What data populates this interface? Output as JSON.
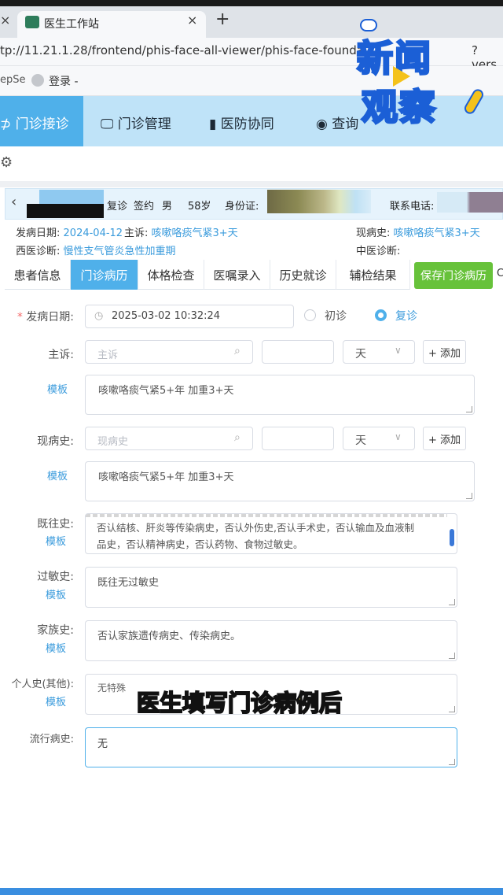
{
  "browser": {
    "tab_close_left": "×",
    "tab_title": "医生工作站",
    "tab_close": "×",
    "new_tab": "+",
    "url": "tp://11.21.1.28/frontend/phis-face-all-viewer/phis-face-founda",
    "url_tail": "?vers",
    "bookmark_left": "epSe",
    "bookmark_login": "登录 -"
  },
  "nav": {
    "items": [
      {
        "label": "门诊接诊"
      },
      {
        "label": "门诊管理"
      },
      {
        "label": "医防协同"
      },
      {
        "label": "查询"
      }
    ]
  },
  "patient": {
    "visit_type": "复诊",
    "contract": "签约",
    "sex": "男",
    "age": "58岁",
    "id_label": "身份证:",
    "phone_label": "联系电话:",
    "onset_label": "发病日期:",
    "onset_date": "2024-04-12",
    "complaint_label": "主诉:",
    "complaint": "咳嗽咯痰气紧3+天",
    "present_label": "现病史:",
    "present": "咳嗽咯痰气紧3+天",
    "western_dx_label": "西医诊断:",
    "western_dx": "慢性支气管炎急性加重期",
    "chinese_dx_label": "中医诊断:"
  },
  "subtabs": {
    "items": [
      {
        "label": "患者信息"
      },
      {
        "label": "门诊病历"
      },
      {
        "label": "体格检查"
      },
      {
        "label": "医嘱录入"
      },
      {
        "label": "历史就诊"
      },
      {
        "label": "辅检结果"
      }
    ],
    "save_label": "保存门诊病历",
    "edge_mark": "C"
  },
  "form": {
    "onset_label": "发病日期:",
    "onset_required": "*",
    "onset_value": "2025-03-02 10:32:24",
    "first_visit": "初诊",
    "return_visit": "复诊",
    "complaint_label": "主诉:",
    "complaint_placeholder": "主诉",
    "unit_day": "天",
    "add_label": "+ 添加",
    "template_label": "模板",
    "complaint_text": "咳嗽咯痰气紧5+年  加重3+天",
    "present_label": "现病史:",
    "present_placeholder": "现病史",
    "present_text": "咳嗽咯痰气紧5+年  加重3+天",
    "past_label": "既往史:",
    "past_line1": "否认结核、肝炎等传染病史，否认外伤史,否认手术史，否认输血及血液制",
    "past_line2": "品史，否认精神病史，否认药物、食物过敏史。",
    "allergy_label": "过敏史:",
    "allergy_text": "既往无过敏史",
    "family_label": "家族史:",
    "family_text": "否认家族遗传病史、传染病史。",
    "personal_label": "个人史(其他):",
    "personal_text": "无特殊",
    "epidemic_label": "流行病史:",
    "epidemic_text": "无"
  },
  "overlay": {
    "logo_line1": "新闻",
    "logo_line2": "观察",
    "caption": "医生填写门诊病例后"
  }
}
